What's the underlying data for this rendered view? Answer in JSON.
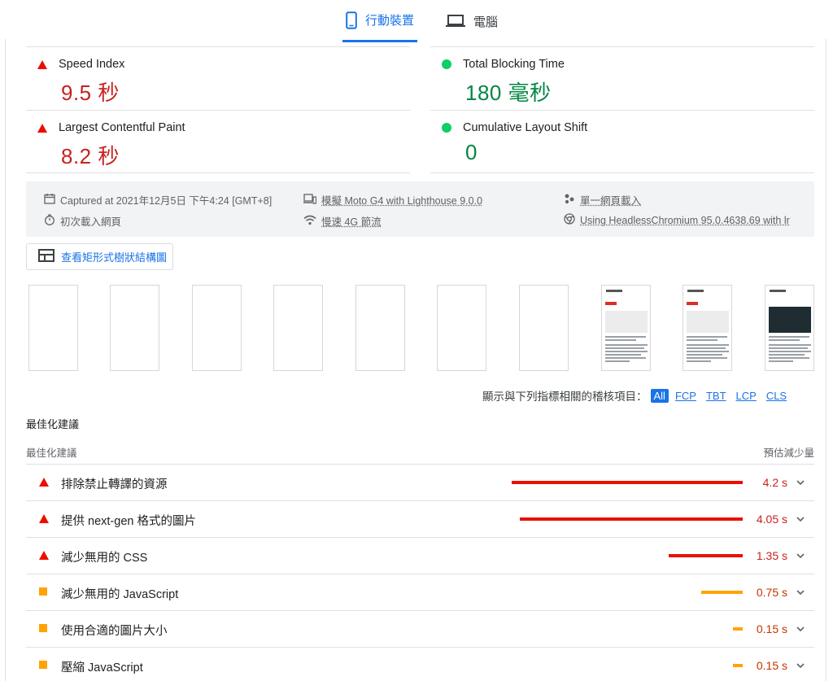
{
  "tabs": {
    "mobile": "行動裝置",
    "desktop": "電腦"
  },
  "metrics": [
    {
      "label": "Speed Index",
      "value": "9.5 秒",
      "status": "fail"
    },
    {
      "label": "Total Blocking Time",
      "value": "180 毫秒",
      "status": "pass"
    },
    {
      "label": "Largest Contentful Paint",
      "value": "8.2 秒",
      "status": "fail"
    },
    {
      "label": "Cumulative Layout Shift",
      "value": "0",
      "status": "pass"
    }
  ],
  "info": {
    "captured": "Captured at 2021年12月5日 下午4:24 [GMT+8]",
    "load": "初次載入網頁",
    "device": "模擬 Moto G4 with Lighthouse 9.0.0",
    "network": "慢速 4G 節流",
    "session": "單一網頁載入",
    "browser": "Using HeadlessChromium 95.0.4638.69 with lr"
  },
  "treemap_button": "查看矩形式樹狀結構圖",
  "filmstrip": {
    "frame_count": 10,
    "thumb_site_name": "優化淡林",
    "thumb_banner": "優化網址 URLs"
  },
  "filter": {
    "label": "顯示與下列指標相關的稽核項目：",
    "chips": [
      "All",
      "FCP",
      "TBT",
      "LCP",
      "CLS"
    ],
    "active": "All"
  },
  "opportunities": {
    "section_title": "最佳化建議",
    "col_left": "最佳化建議",
    "col_right": "預估減少量",
    "items": [
      {
        "title": "排除禁止轉譯的資源",
        "savings": "4.2 s",
        "savings_seconds": 4.2,
        "status": "fail"
      },
      {
        "title": "提供 next-gen 格式的圖片",
        "savings": "4.05 s",
        "savings_seconds": 4.05,
        "status": "fail"
      },
      {
        "title": "減少無用的 CSS",
        "savings": "1.35 s",
        "savings_seconds": 1.35,
        "status": "fail"
      },
      {
        "title": "減少無用的 JavaScript",
        "savings": "0.75 s",
        "savings_seconds": 0.75,
        "status": "average"
      },
      {
        "title": "使用合適的圖片大小",
        "savings": "0.15 s",
        "savings_seconds": 0.15,
        "status": "average"
      },
      {
        "title": "壓縮 JavaScript",
        "savings": "0.15 s",
        "savings_seconds": 0.15,
        "status": "average"
      }
    ]
  },
  "colors": {
    "accent": "#1a73e8",
    "fail": "#eb0f00",
    "average": "#ffa400",
    "pass": "#0cce6b"
  }
}
